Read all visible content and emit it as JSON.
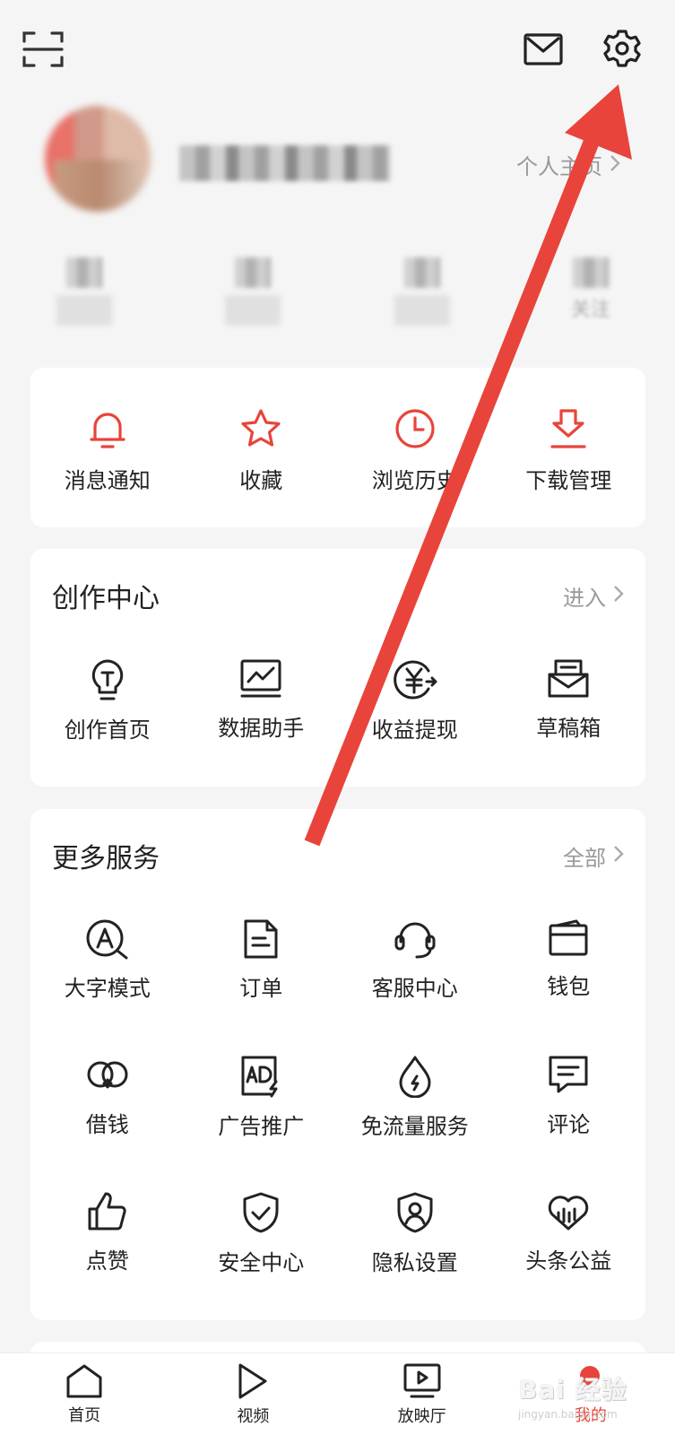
{
  "topbar": {
    "scan_icon": "scan-icon",
    "mail_icon": "mail-icon",
    "settings_icon": "gear-icon"
  },
  "profile": {
    "homepage_label": "个人主页",
    "stats_visible_label": "关注"
  },
  "quick_actions": [
    {
      "label": "消息通知",
      "icon": "bell-icon"
    },
    {
      "label": "收藏",
      "icon": "star-icon"
    },
    {
      "label": "浏览历史",
      "icon": "clock-icon"
    },
    {
      "label": "下载管理",
      "icon": "download-icon"
    }
  ],
  "creation_center": {
    "title": "创作中心",
    "more_label": "进入",
    "items": [
      {
        "label": "创作首页",
        "icon": "bulb-icon"
      },
      {
        "label": "数据助手",
        "icon": "chart-monitor-icon"
      },
      {
        "label": "收益提现",
        "icon": "yuan-icon"
      },
      {
        "label": "草稿箱",
        "icon": "drafts-icon"
      }
    ]
  },
  "more_services": {
    "title": "更多服务",
    "more_label": "全部",
    "items": [
      {
        "label": "大字模式",
        "icon": "large-font-icon"
      },
      {
        "label": "订单",
        "icon": "order-icon"
      },
      {
        "label": "客服中心",
        "icon": "headset-icon"
      },
      {
        "label": "钱包",
        "icon": "wallet-icon"
      },
      {
        "label": "借钱",
        "icon": "loan-icon"
      },
      {
        "label": "广告推广",
        "icon": "ad-icon"
      },
      {
        "label": "免流量服务",
        "icon": "data-free-icon"
      },
      {
        "label": "评论",
        "icon": "comment-icon"
      },
      {
        "label": "点赞",
        "icon": "thumb-up-icon"
      },
      {
        "label": "安全中心",
        "icon": "shield-check-icon"
      },
      {
        "label": "隐私设置",
        "icon": "privacy-icon"
      },
      {
        "label": "头条公益",
        "icon": "charity-icon"
      }
    ]
  },
  "tabbar": {
    "tabs": [
      {
        "label": "首页",
        "icon": "home-icon"
      },
      {
        "label": "视频",
        "icon": "play-icon"
      },
      {
        "label": "放映厅",
        "icon": "screen-icon"
      },
      {
        "label": "我的",
        "icon": "profile-icon"
      }
    ],
    "active_index": 3
  },
  "watermark": {
    "text": "Bai 经验",
    "sub": "jingyan.baidu.com"
  },
  "colors": {
    "accent": "#e8443b",
    "annotation_arrow": "#e8443b",
    "background": "#f5f5f5",
    "card": "#ffffff"
  }
}
